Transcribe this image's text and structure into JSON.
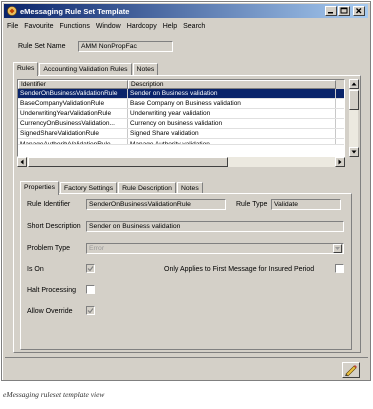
{
  "window": {
    "title": "eMessaging Rule Set Template"
  },
  "menu": [
    "File",
    "Favourite",
    "Functions",
    "Window",
    "Hardcopy",
    "Help",
    "Search"
  ],
  "rule_set": {
    "label": "Rule Set Name",
    "value": "AMM NonPropFac"
  },
  "main_tabs": [
    "Rules",
    "Accounting Validation Rules",
    "Notes"
  ],
  "grid": {
    "headers": [
      "Identifier",
      "Description"
    ],
    "rows": [
      [
        "SenderOnBusinessValidationRule",
        "Sender on Business validation"
      ],
      [
        "BaseCompanyValidationRule",
        "Base Company on Business validation"
      ],
      [
        "UnderwritingYearValidationRule",
        "Underwriting year validation"
      ],
      [
        "CurrencyOnBusinessValidation...",
        "Currency on business validation"
      ],
      [
        "SignedShareValidationRule",
        "Signed Share validation"
      ],
      [
        "ManageAuthorityValidationRule",
        "Manage Authority validation"
      ]
    ]
  },
  "detail_tabs": [
    "Properties",
    "Factory Settings",
    "Rule Description",
    "Notes"
  ],
  "properties": {
    "rule_identifier_label": "Rule Identifier",
    "rule_identifier_value": "SenderOnBusinessValidationRule",
    "rule_type_label": "Rule Type",
    "rule_type_value": "Validate",
    "short_description_label": "Short Description",
    "short_description_value": "Sender on Business validation",
    "problem_type_label": "Problem Type",
    "problem_type_value": "Error",
    "is_on_label": "Is On",
    "only_applies_label": "Only Applies to First Message for Insured Period",
    "halt_processing_label": "Halt Processing",
    "allow_override_label": "Allow Override",
    "is_on_checked": true,
    "halt_processing_checked": false,
    "allow_override_checked": true,
    "only_applies_checked": false
  },
  "caption": "eMessaging ruleset template view"
}
